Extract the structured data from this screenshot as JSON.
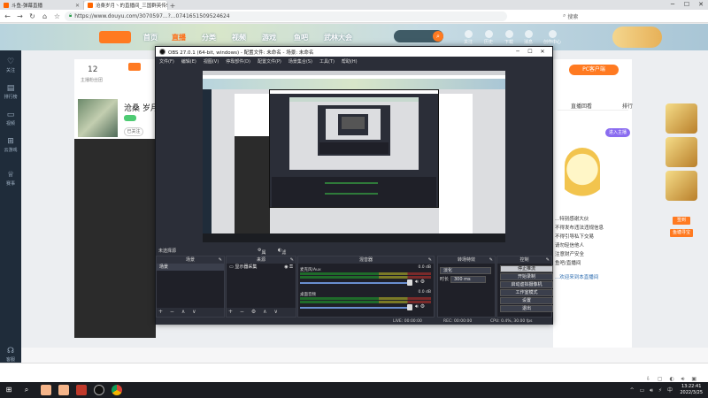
{
  "browser": {
    "tabs": [
      {
        "title": "斗鱼-弹幕直播"
      },
      {
        "title": "沧桑岁月丶的直播间_三国群英传5直"
      }
    ],
    "new_tab": "+",
    "url": "https://www.douyu.com/3070597...?...0741651509524624",
    "search_label": "搜索",
    "window_controls": [
      "─",
      "☐",
      "✕"
    ]
  },
  "site": {
    "nav": [
      "首页",
      "直播",
      "分类",
      "视频",
      "游戏",
      "鱼吧",
      "武林大会"
    ],
    "search_placeholder": "",
    "top_icons": [
      "关注",
      "历史",
      "下载",
      "消息",
      "创作中心"
    ],
    "left_nav": [
      "关注",
      "排行榜",
      "视频",
      "云游戏",
      "赛事",
      "客服"
    ],
    "profile": {
      "fans_count": "12",
      "fans_label": "主播粉丝团",
      "badge": "",
      "streamer_name": "沧桑 岁月",
      "follow_btn": "已关注"
    },
    "right": {
      "pc_button": "PC客户端",
      "tabs": [
        "直播回看",
        "",
        "排行"
      ],
      "purple_btn": "进入主播",
      "chat": [
        "...特别感谢大伙",
        "不得发布违法违规信息",
        "不得引导私下交易",
        "请勿轻信他人",
        "注意财产安全",
        "",
        "鱼吧/直播间"
      ],
      "chat_hl": "...欢迎来到本直播间"
    },
    "ads": [
      "签到",
      "鱼塘寻宝"
    ]
  },
  "obs": {
    "title": "OBS 27.0.1 (64-bit, windows) - 配置文件: 未命名 - 场景: 未命名",
    "menu": [
      "文件(F)",
      "编辑(E)",
      "视图(V)",
      "停靠部件(D)",
      "配置文件(P)",
      "场景集合(S)",
      "工具(T)",
      "帮助(H)"
    ],
    "scene_bar": {
      "left": "未选择源",
      "mid1": "属性",
      "mid2": "滤镜"
    },
    "docks": {
      "scenes": {
        "title": "场景",
        "items": [
          "场景"
        ]
      },
      "sources": {
        "title": "来源",
        "items": [
          "显示器采集"
        ]
      },
      "mixer": {
        "title": "混音器",
        "channels": [
          {
            "name": "麦克风/Aux",
            "db": "0.0 dB"
          },
          {
            "name": "桌面音频",
            "db": "0.0 dB"
          }
        ]
      },
      "transitions": {
        "title": "转场特效",
        "selected": "淡化",
        "duration_label": "时长",
        "duration_value": "300 ms"
      },
      "controls": {
        "title": "控制",
        "buttons": [
          "停止推流",
          "开始录制",
          "启动虚拟摄像机",
          "工作室模式",
          "设置",
          "退出"
        ]
      }
    },
    "status": {
      "live": "LIVE: 00:00:00",
      "rec": "REC: 00:00:00",
      "cpu": "CPU: 0.4%, 30.00 fps"
    }
  },
  "taskbar": {
    "clock_time": "13:22:41",
    "clock_date": "2022/3/25"
  }
}
